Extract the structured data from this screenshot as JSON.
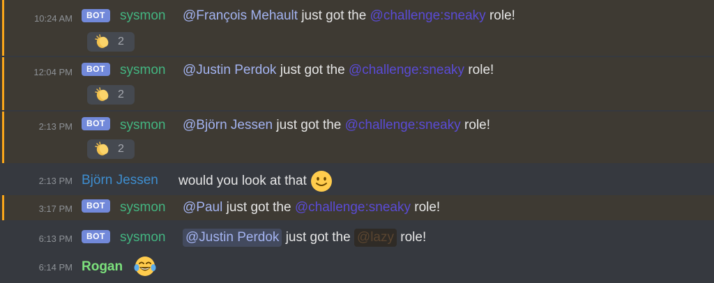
{
  "messages": [
    {
      "time": "10:24 AM",
      "badge": "BOT",
      "author": "sysmon",
      "user_mention": "@François Mehault",
      "text_mid": "just got the",
      "role_mention": "@challenge:sneaky",
      "text_end": "role!",
      "reaction": {
        "emoji": "clapping-hands",
        "count": "2"
      }
    },
    {
      "time": "12:04 PM",
      "badge": "BOT",
      "author": "sysmon",
      "user_mention": "@Justin Perdok",
      "text_mid": "just got the",
      "role_mention": "@challenge:sneaky",
      "text_end": "role!",
      "reaction": {
        "emoji": "clapping-hands",
        "count": "2"
      }
    },
    {
      "time": "2:13 PM",
      "badge": "BOT",
      "author": "sysmon",
      "user_mention": "@Björn Jessen",
      "text_mid": "just got the",
      "role_mention": "@challenge:sneaky",
      "text_end": "role!",
      "reaction": {
        "emoji": "clapping-hands",
        "count": "2"
      }
    },
    {
      "time": "2:13 PM",
      "author": "Björn Jessen",
      "text": "would you look at that",
      "emoji": "slightly-smiling-face"
    },
    {
      "time": "3:17 PM",
      "badge": "BOT",
      "author": "sysmon",
      "user_mention": "@Paul",
      "text_mid": "just got the",
      "role_mention": "@challenge:sneaky",
      "text_end": "role!"
    },
    {
      "time": "6:13 PM",
      "badge": "BOT",
      "author": "sysmon",
      "user_mention": "@Justin Perdok",
      "text_mid": "just got the",
      "role_mention": "@lazy",
      "text_end": "role!"
    },
    {
      "time": "6:14 PM",
      "author": "Rogan",
      "emoji": "face-with-tears-of-joy"
    }
  ],
  "colors": {
    "background": "#36393f",
    "mention_highlight": "#3e3a33",
    "mention_bar": "#faa61a",
    "bot_badge": "#7289da",
    "sysmon": "#43b581",
    "bjorn": "#3e8ed0",
    "rogan": "#7ce17c",
    "role_sneaky": "#5a4bd6",
    "role_lazy": "#5a4530"
  }
}
